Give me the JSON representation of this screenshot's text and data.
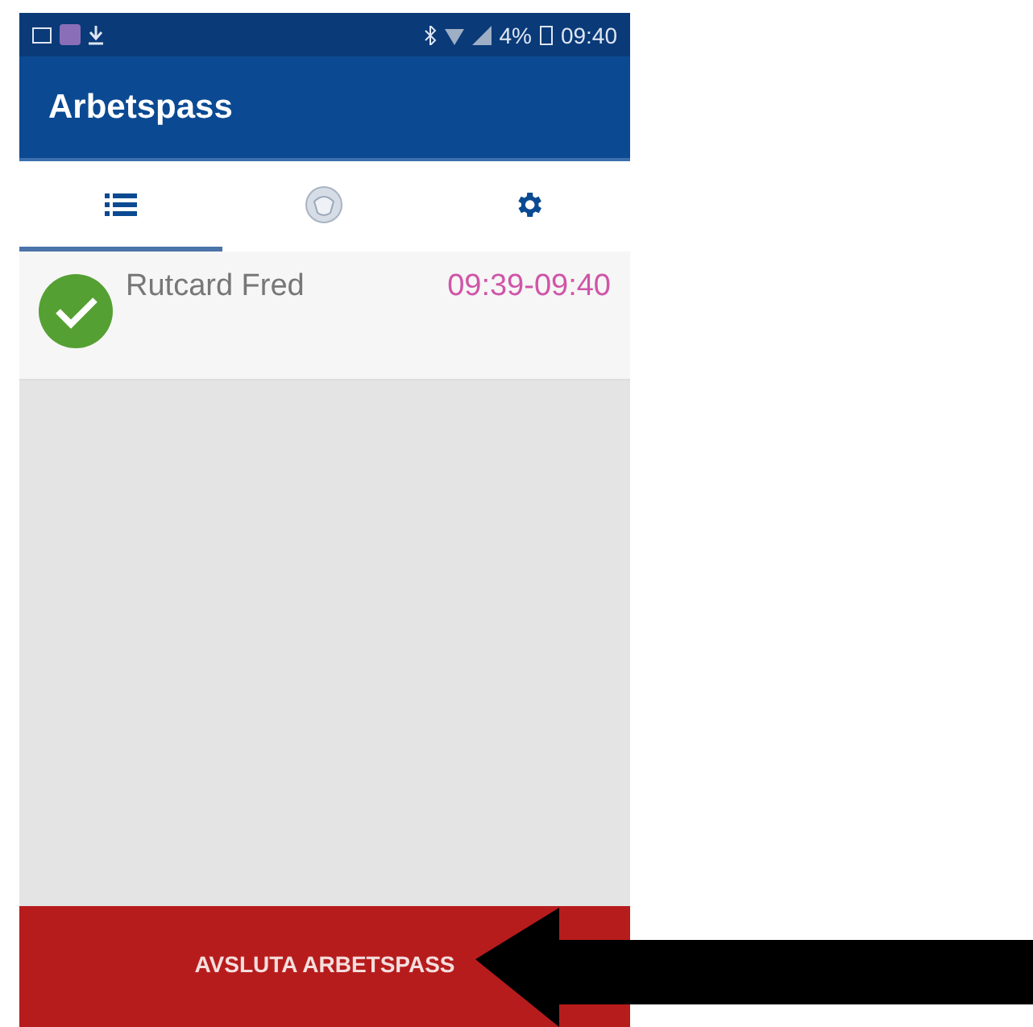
{
  "status_bar": {
    "battery": "4%",
    "time": "09:40"
  },
  "app_bar": {
    "title": "Arbetspass"
  },
  "tabs": [
    {
      "kind": "list",
      "selected": true
    },
    {
      "kind": "badge",
      "selected": false
    },
    {
      "kind": "settings",
      "selected": false
    }
  ],
  "shifts": [
    {
      "name": "Rutcard Fred",
      "time": "09:39-09:40",
      "done": true
    }
  ],
  "end_button": {
    "label": "AVSLUTA ARBETSPASS"
  },
  "annotation": {
    "kind": "arrow"
  }
}
